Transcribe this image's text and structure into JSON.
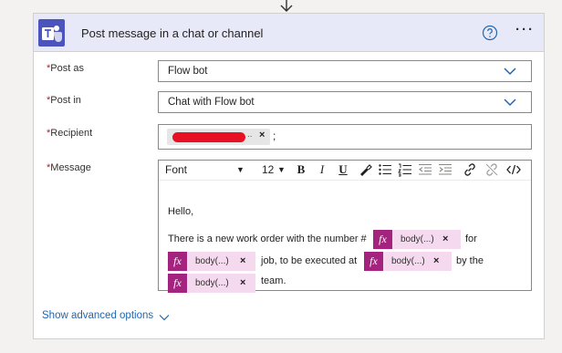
{
  "card": {
    "title": "Post message in a chat or channel"
  },
  "fields": {
    "post_as": {
      "label": "Post as",
      "value": "Flow bot"
    },
    "post_in": {
      "label": "Post in",
      "value": "Chat with Flow bot"
    },
    "recipient": {
      "label": "Recipient",
      "overflow": "..",
      "separator": ";"
    },
    "message": {
      "label": "Message"
    }
  },
  "required_marker": "*",
  "toolbar": {
    "font": "Font",
    "font_size": "12",
    "bold": "B",
    "italic": "I",
    "underline": "U"
  },
  "message": {
    "greeting": "Hello,",
    "line1_text": "There is a new work order with the number #",
    "line1_after": "for",
    "line2_after": "job, to be executed at",
    "line2_end": "by the",
    "line3_after": "team.",
    "token_label": "body(...)",
    "token_fx": "fx",
    "token_remove": "×"
  },
  "advanced_label": "Show advanced options",
  "colors": {
    "header_bg": "#e8e9f8",
    "teams_brand": "#4b53bc",
    "expression_token": "#a4237f",
    "token_bg": "#f5d9ef",
    "link": "#2266b0"
  },
  "icons": {
    "teams": "teams-logo-icon",
    "help": "question-circle-icon",
    "more": "ellipsis-icon",
    "dropdown": "chevron-down-icon",
    "expression": "fx-icon"
  }
}
